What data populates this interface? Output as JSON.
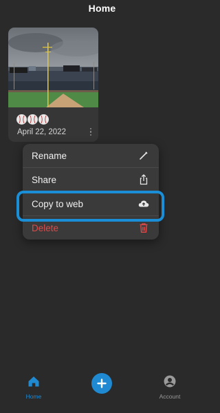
{
  "header": {
    "title": "Home"
  },
  "card": {
    "date": "April 22, 2022",
    "rating_balls": 3
  },
  "context_menu": {
    "items": [
      {
        "label": "Rename",
        "icon": "pencil-icon"
      },
      {
        "label": "Share",
        "icon": "share-icon"
      },
      {
        "label": "Copy to web",
        "icon": "cloud-upload-icon",
        "highlighted": true
      },
      {
        "label": "Delete",
        "icon": "trash-icon",
        "destructive": true
      }
    ]
  },
  "tabbar": {
    "home_label": "Home",
    "account_label": "Account",
    "active_color": "#1f8ad2",
    "inactive_color": "#9a9a9a"
  },
  "colors": {
    "accent": "#1f8ad2",
    "danger": "#e04a4a",
    "background": "#2a2a2a"
  }
}
